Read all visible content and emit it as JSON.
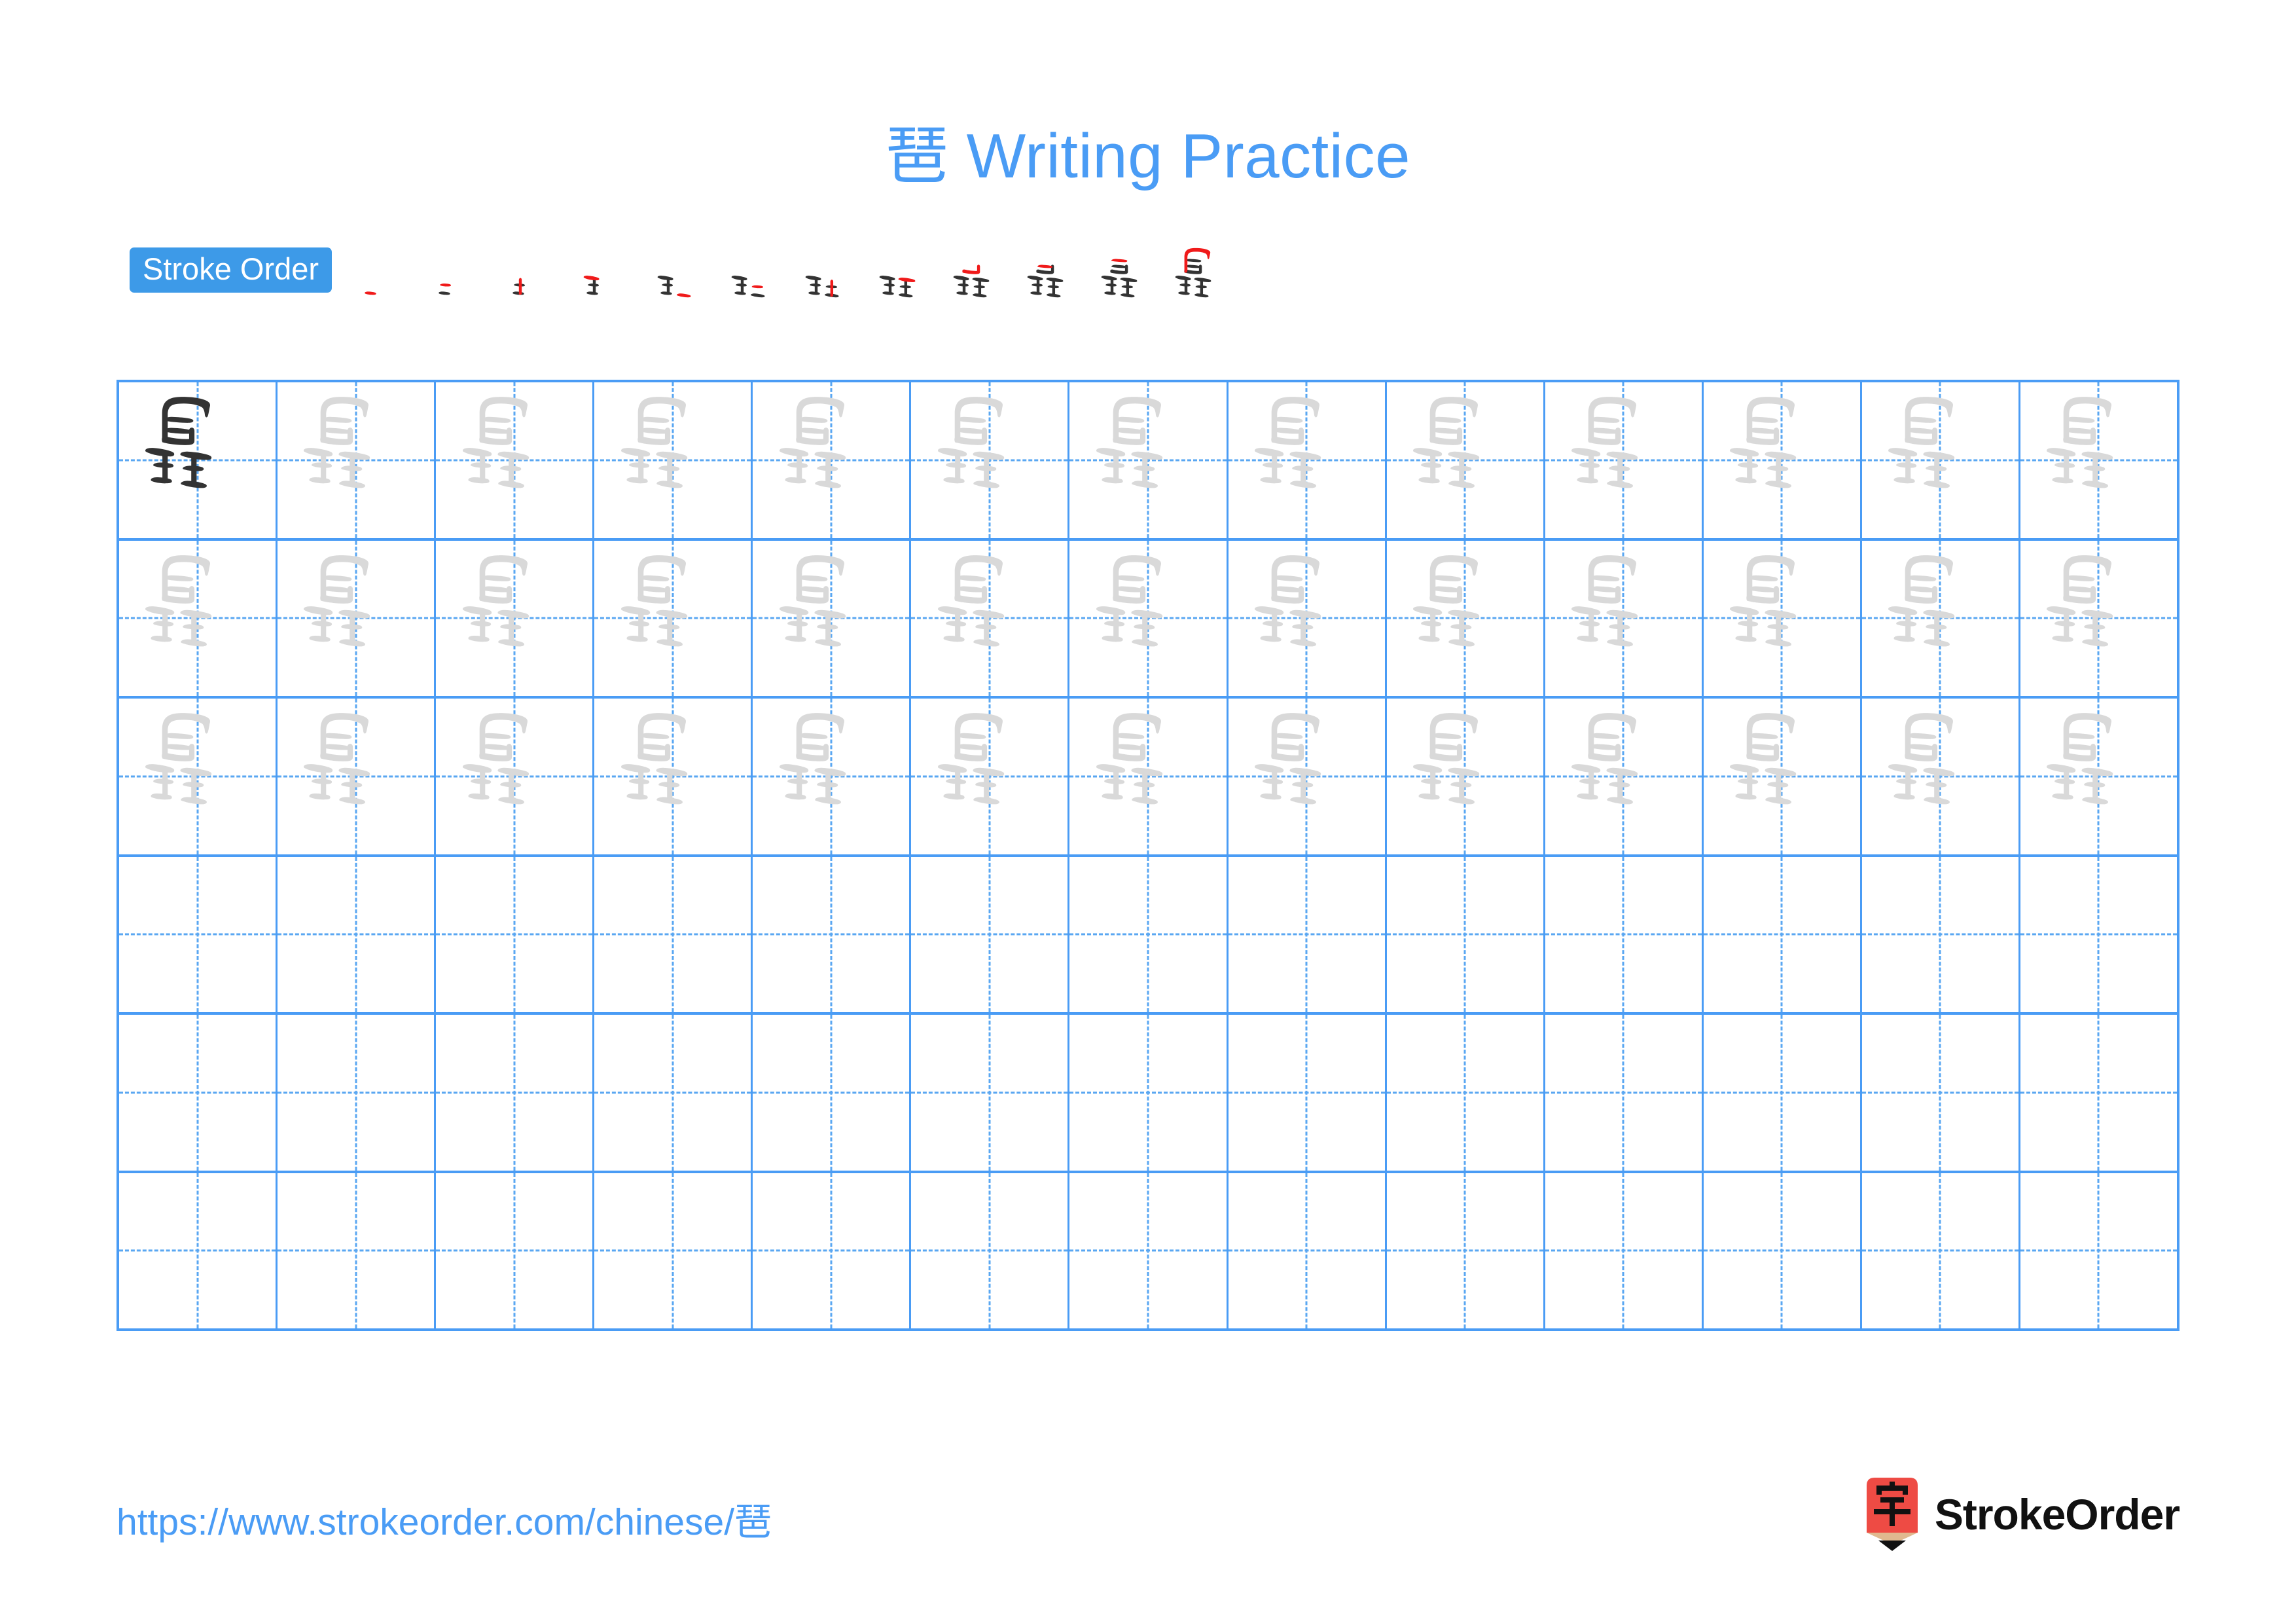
{
  "character": "琶",
  "title": "琶 Writing Practice",
  "colors": {
    "accent_blue": "#4a9cf5",
    "badge_blue": "#3d9ae8",
    "grid_line": "#4a9cf5",
    "guide_dash": "#5aa7f2",
    "ink_dark": "#333333",
    "trace_grey": "#d9d9d9",
    "new_stroke_red": "#f01a1a",
    "logo_red": "#ee4b44",
    "logo_wood": "#e0b98f"
  },
  "stroke_order": {
    "label": "Stroke Order",
    "total_strokes": 12,
    "steps": [
      {
        "index": 1,
        "strokes_shown": 1,
        "new_stroke": 1
      },
      {
        "index": 2,
        "strokes_shown": 2,
        "new_stroke": 2
      },
      {
        "index": 3,
        "strokes_shown": 3,
        "new_stroke": 3
      },
      {
        "index": 4,
        "strokes_shown": 4,
        "new_stroke": 4
      },
      {
        "index": 5,
        "strokes_shown": 5,
        "new_stroke": 5
      },
      {
        "index": 6,
        "strokes_shown": 6,
        "new_stroke": 6
      },
      {
        "index": 7,
        "strokes_shown": 7,
        "new_stroke": 7
      },
      {
        "index": 8,
        "strokes_shown": 8,
        "new_stroke": 8
      },
      {
        "index": 9,
        "strokes_shown": 9,
        "new_stroke": 9
      },
      {
        "index": 10,
        "strokes_shown": 10,
        "new_stroke": 10
      },
      {
        "index": 11,
        "strokes_shown": 11,
        "new_stroke": 11
      },
      {
        "index": 12,
        "strokes_shown": 12,
        "new_stroke": 12
      }
    ]
  },
  "practice_grid": {
    "columns": 13,
    "rows": 6,
    "cells": [
      [
        "dark",
        "trace",
        "trace",
        "trace",
        "trace",
        "trace",
        "trace",
        "trace",
        "trace",
        "trace",
        "trace",
        "trace",
        "trace"
      ],
      [
        "trace",
        "trace",
        "trace",
        "trace",
        "trace",
        "trace",
        "trace",
        "trace",
        "trace",
        "trace",
        "trace",
        "trace",
        "trace"
      ],
      [
        "trace",
        "trace",
        "trace",
        "trace",
        "trace",
        "trace",
        "trace",
        "trace",
        "trace",
        "trace",
        "trace",
        "trace",
        "trace"
      ],
      [
        "empty",
        "empty",
        "empty",
        "empty",
        "empty",
        "empty",
        "empty",
        "empty",
        "empty",
        "empty",
        "empty",
        "empty",
        "empty"
      ],
      [
        "empty",
        "empty",
        "empty",
        "empty",
        "empty",
        "empty",
        "empty",
        "empty",
        "empty",
        "empty",
        "empty",
        "empty",
        "empty"
      ],
      [
        "empty",
        "empty",
        "empty",
        "empty",
        "empty",
        "empty",
        "empty",
        "empty",
        "empty",
        "empty",
        "empty",
        "empty",
        "empty"
      ]
    ]
  },
  "footer": {
    "url": "https://www.strokeorder.com/chinese/琶",
    "brand": "StrokeOrder",
    "logo_glyph": "字"
  }
}
